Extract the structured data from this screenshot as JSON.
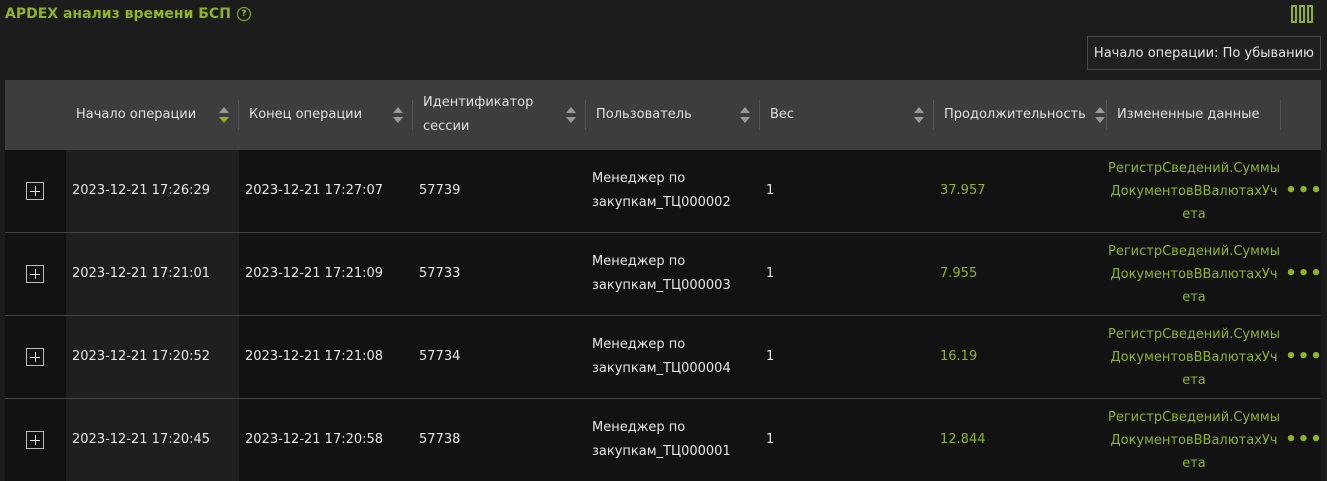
{
  "header": {
    "title": "APDEX анализ времени БСП",
    "help_symbol": "?",
    "sort_label": "Начало операции: По убыванию"
  },
  "columns": [
    {
      "key": "start",
      "label": "Начало операции",
      "sortable": true,
      "active": true
    },
    {
      "key": "end",
      "label": "Конец операции",
      "sortable": true
    },
    {
      "key": "session",
      "label": "Идентификатор сессии",
      "sortable": true
    },
    {
      "key": "user",
      "label": "Пользователь",
      "sortable": true
    },
    {
      "key": "weight",
      "label": "Вес",
      "sortable": true
    },
    {
      "key": "duration",
      "label": "Продолжительность",
      "sortable": true
    },
    {
      "key": "changed",
      "label": "Измененные данные",
      "sortable": false
    }
  ],
  "rows": [
    {
      "start": "2023-12-21 17:26:29",
      "end": "2023-12-21 17:27:07",
      "session": "57739",
      "user": "Менеджер по закупкам_ТЦ000002",
      "weight": "1",
      "duration": "37.957",
      "changed": "РегистрСведений.СуммыДокументовВВалютахУчета"
    },
    {
      "start": "2023-12-21 17:21:01",
      "end": "2023-12-21 17:21:09",
      "session": "57733",
      "user": "Менеджер по закупкам_ТЦ000003",
      "weight": "1",
      "duration": "7.955",
      "changed": "РегистрСведений.СуммыДокументовВВалютахУчета"
    },
    {
      "start": "2023-12-21 17:20:52",
      "end": "2023-12-21 17:21:08",
      "session": "57734",
      "user": "Менеджер по закупкам_ТЦ000004",
      "weight": "1",
      "duration": "16.19",
      "changed": "РегистрСведений.СуммыДокументовВВалютахУчета"
    },
    {
      "start": "2023-12-21 17:20:45",
      "end": "2023-12-21 17:20:58",
      "session": "57738",
      "user": "Менеджер по закупкам_ТЦ000001",
      "weight": "1",
      "duration": "12.844",
      "changed": "РегистрСведений.СуммыДокументовВВалютахУчета"
    }
  ],
  "more_symbol": "•••",
  "colors": {
    "accent": "#8fb51b",
    "background": "#1c1c1c",
    "header_bg": "#3d3d3d"
  }
}
